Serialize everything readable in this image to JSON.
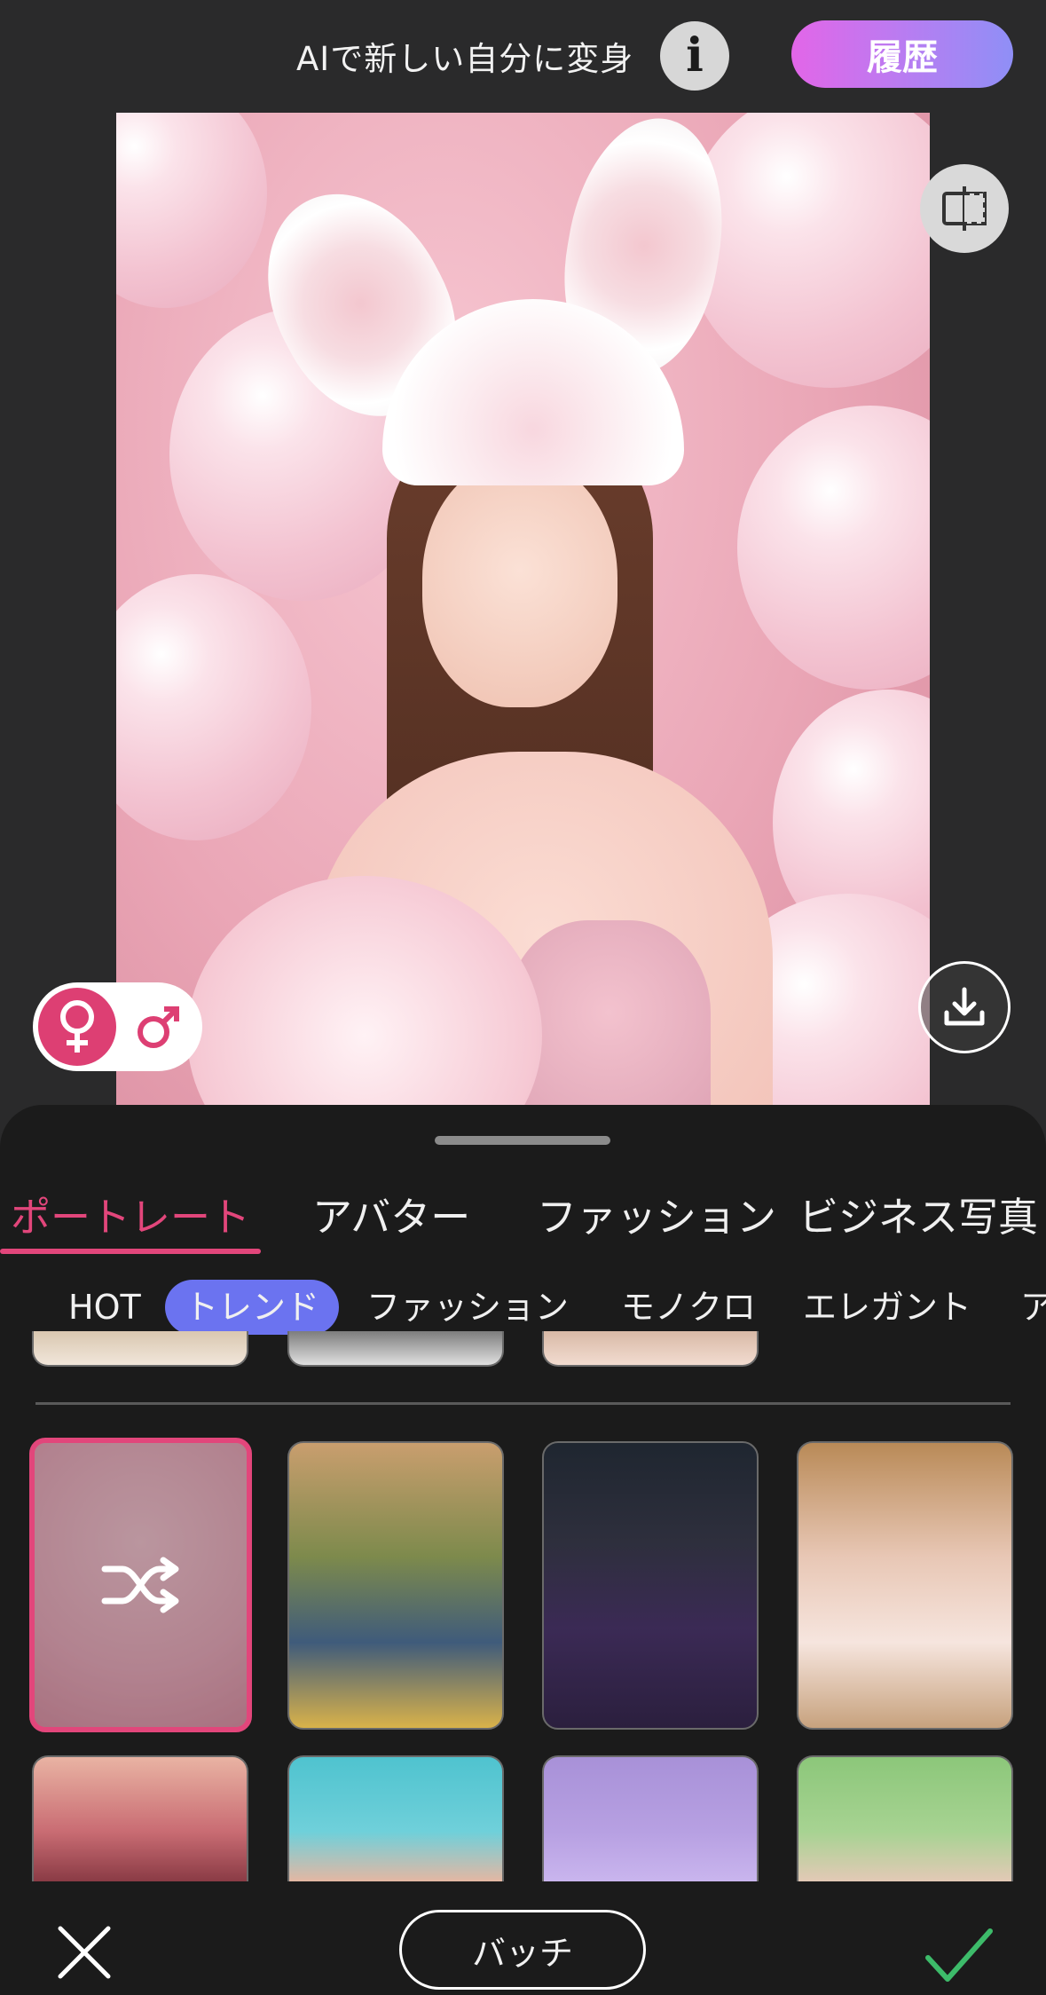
{
  "header": {
    "title": "AIで新しい自分に変身",
    "info_icon": "i",
    "history_label": "履歴"
  },
  "gender": {
    "female_symbol": "♀",
    "male_symbol": "♂",
    "selected": "female"
  },
  "main_tabs": [
    {
      "label": "ポートレート",
      "active": true
    },
    {
      "label": "アバター",
      "active": false
    },
    {
      "label": "ファッション",
      "active": false
    },
    {
      "label": "ビジネス写真",
      "active": false
    }
  ],
  "sub_tabs": [
    {
      "label": "HOT",
      "active": false
    },
    {
      "label": "トレンド",
      "active": true
    },
    {
      "label": "ファッション",
      "active": false
    },
    {
      "label": "モノクロ",
      "active": false
    },
    {
      "label": "エレガント",
      "active": false
    },
    {
      "label": "ア",
      "active": false
    }
  ],
  "bottom": {
    "batch_label": "バッチ"
  },
  "colors": {
    "accent_pink": "#e2467b",
    "sub_tab_active": "#6b73f0",
    "history_gradient_start": "#e266e8",
    "history_gradient_end": "#8f8ff6",
    "confirm_green": "#3dbb6a"
  },
  "icons": [
    "info-icon",
    "compare-icon",
    "download-icon",
    "female-icon",
    "male-icon",
    "shuffle-icon",
    "close-icon",
    "check-icon"
  ]
}
